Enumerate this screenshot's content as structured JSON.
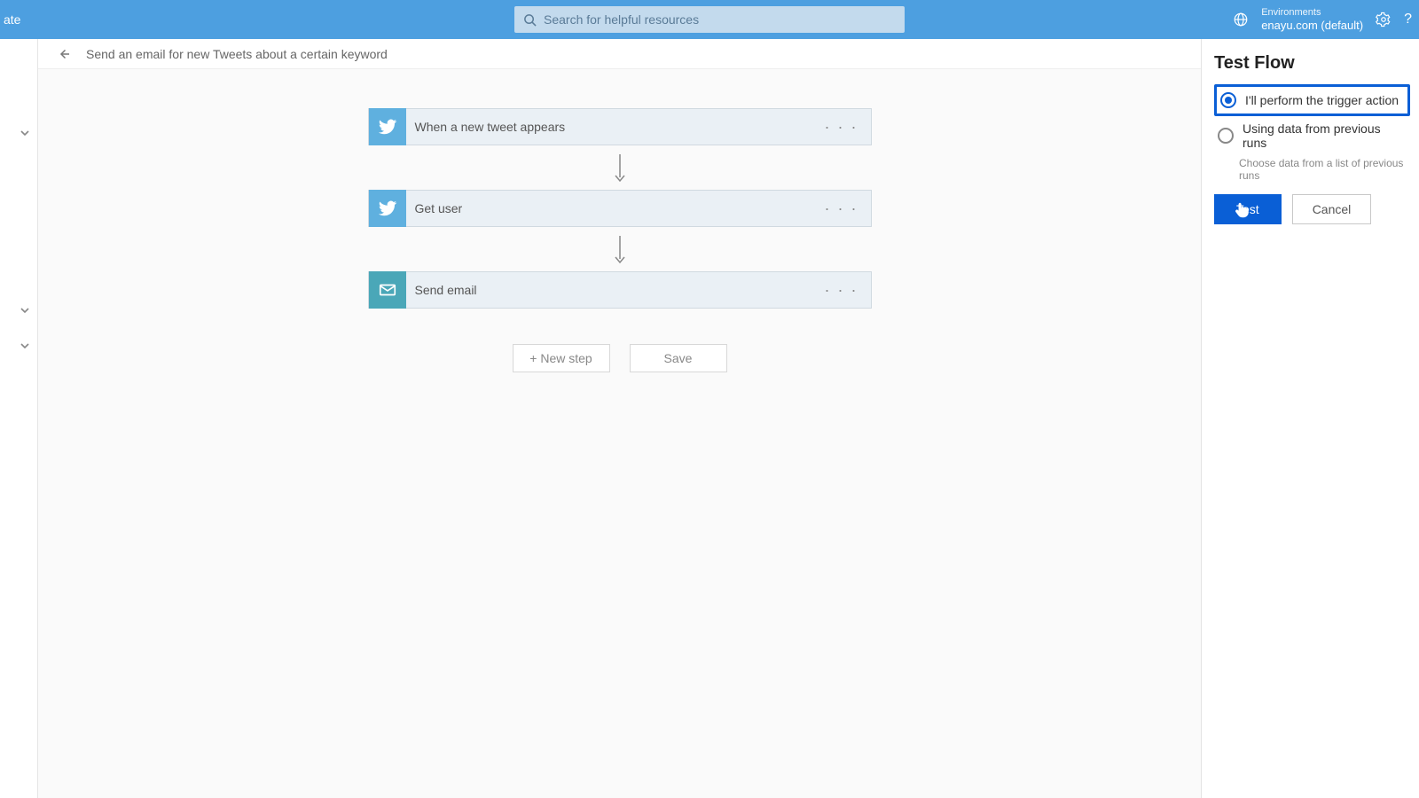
{
  "topbar": {
    "left_fragment": "ate",
    "search_placeholder": "Search for helpful resources",
    "env_label": "Environments",
    "env_value": "enayu.com (default)"
  },
  "breadcrumb": {
    "title": "Send an email for new Tweets about a certain keyword"
  },
  "steps": [
    {
      "label": "When a new tweet appears",
      "icon": "twitter"
    },
    {
      "label": "Get user",
      "icon": "twitter"
    },
    {
      "label": "Send email",
      "icon": "mail"
    }
  ],
  "buttons": {
    "new_step": "+ New step",
    "save": "Save"
  },
  "test_panel": {
    "title": "Test Flow",
    "option_perform": "I'll perform the trigger action",
    "option_previous": "Using data from previous runs",
    "previous_hint": "Choose data from a list of previous runs",
    "test_label": "Test",
    "cancel_label": "Cancel"
  }
}
